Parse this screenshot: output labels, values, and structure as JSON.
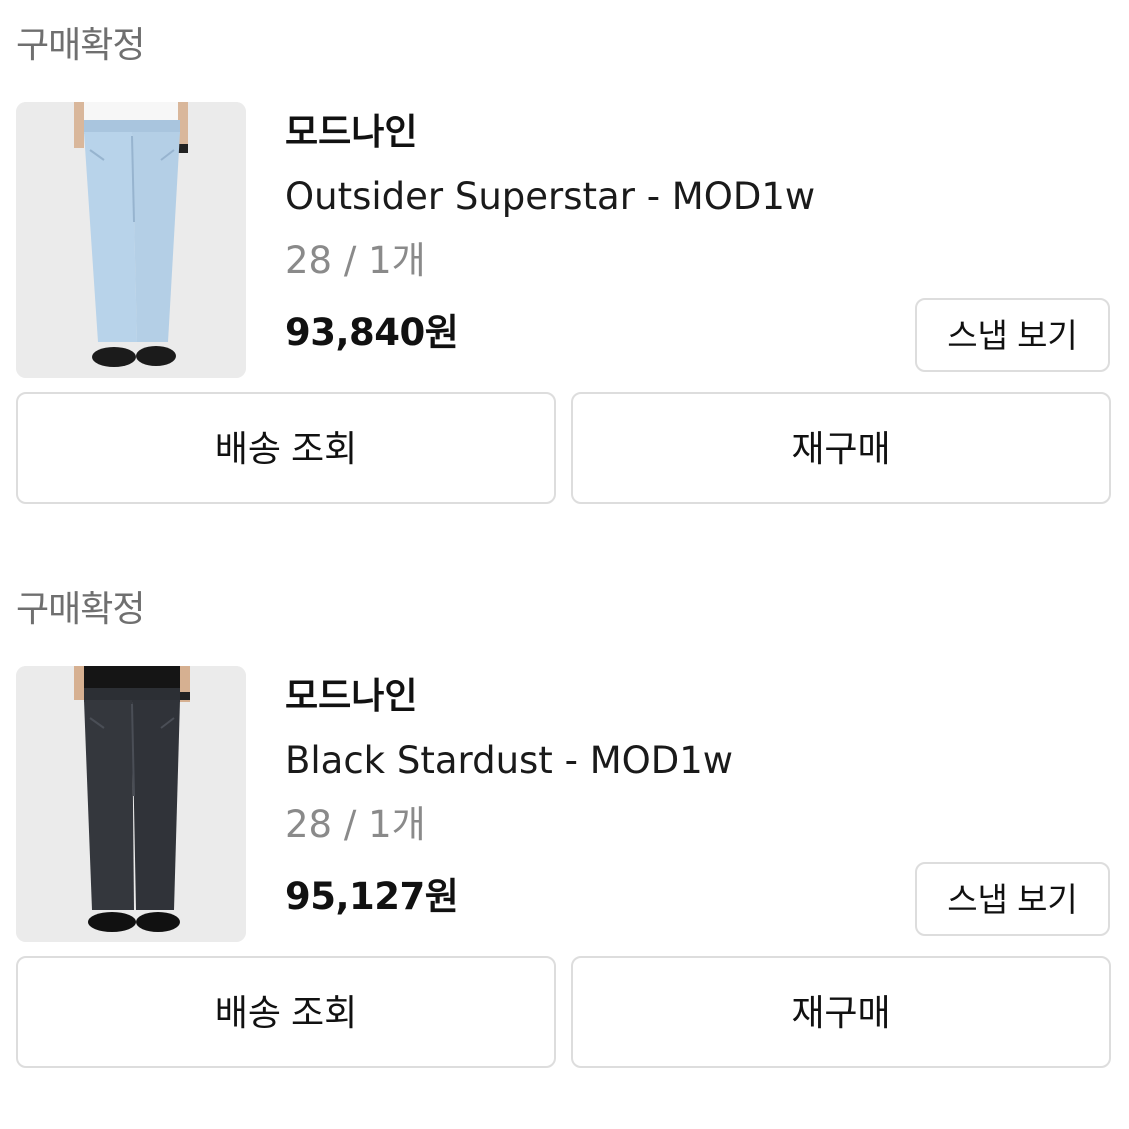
{
  "orders": [
    {
      "status": "구매확정",
      "brand": "모드나인",
      "product_name": "Outsider Superstar - MOD1w",
      "option": "28 / 1개",
      "price": "93,840원",
      "snap_button": "스냅 보기",
      "track_button": "배송 조회",
      "rebuy_button": "재구매",
      "image": "light-blue-wide-jeans-photo",
      "jeans_color": "#b8d3ea"
    },
    {
      "status": "구매확정",
      "brand": "모드나인",
      "product_name": "Black Stardust - MOD1w",
      "option": "28 / 1개",
      "price": "95,127원",
      "snap_button": "스냅 보기",
      "track_button": "배송 조회",
      "rebuy_button": "재구매",
      "image": "black-wide-jeans-photo",
      "jeans_color": "#34373d"
    }
  ]
}
